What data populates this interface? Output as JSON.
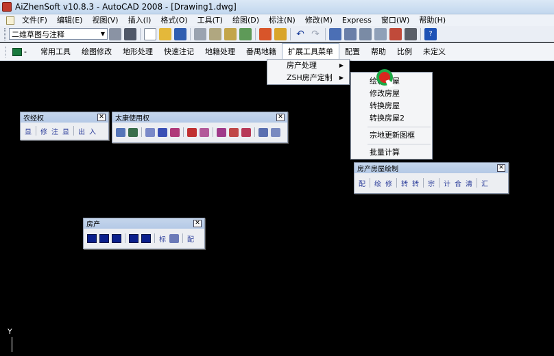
{
  "window": {
    "title": "AiZhenSoft v10.8.3 - AutoCAD 2008 - [Drawing1.dwg]"
  },
  "menubar": {
    "items": [
      "文件(F)",
      "编辑(E)",
      "视图(V)",
      "插入(I)",
      "格式(O)",
      "工具(T)",
      "绘图(D)",
      "标注(N)",
      "修改(M)",
      "Express",
      "窗口(W)",
      "帮助(H)"
    ]
  },
  "toolbar": {
    "workspace_value": "二维草图与注释"
  },
  "custom_menu": {
    "prefix": "-",
    "items": [
      "常用工具",
      "绘图修改",
      "地形处理",
      "快速注记",
      "地籍处理",
      "番禺地籍",
      "扩展工具菜单",
      "配置",
      "帮助",
      "比例",
      "未定义"
    ]
  },
  "dropdown": {
    "items": [
      "房产处理",
      "ZSH房产定制"
    ]
  },
  "submenu": {
    "items": [
      "绘制房屋",
      "修改房屋",
      "转换房屋",
      "转换房屋2",
      "宗地更新图框",
      "批量计算"
    ]
  },
  "panels": {
    "nongjingquan": {
      "title": "农经权",
      "buttons": [
        "显",
        "修",
        "注",
        "显",
        "出",
        "入"
      ]
    },
    "taikang": {
      "title": "太康使用权"
    },
    "fangchan": {
      "title": "房产",
      "buttons": [
        "标",
        "配"
      ]
    },
    "fangchan_draw": {
      "title": "房产房屋绘制",
      "buttons": [
        "配",
        "绘",
        "修",
        "转",
        "转",
        "宗",
        "计",
        "合",
        "清",
        "汇"
      ]
    }
  },
  "ucs": {
    "label": "Y"
  },
  "colors": {
    "accent": "#c5d6ec",
    "cursor_ring": "#1ea845",
    "cursor_fill": "#d9271e"
  }
}
